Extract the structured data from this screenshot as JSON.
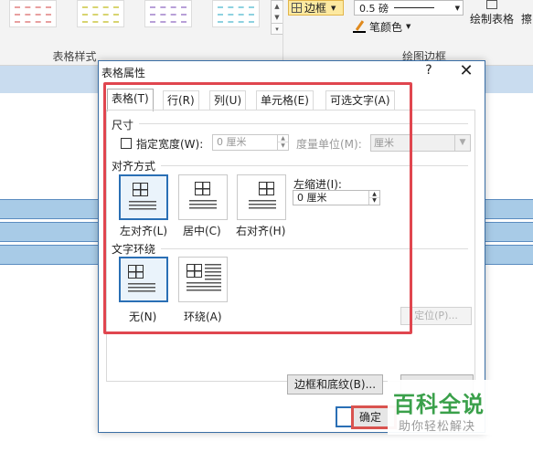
{
  "ribbon": {
    "group_table_styles_label": "表格样式",
    "border_button_label": "边框",
    "pen_weight_value": "0.5 磅",
    "pen_color_label": "笔颜色",
    "draw_table_label": "绘制表格",
    "eraser_label_partial": "擦",
    "group_draw_borders_label": "绘图边框"
  },
  "dialog": {
    "title": "表格属性",
    "help_glyph": "?",
    "close_glyph": "✕",
    "tabs": [
      {
        "label": "表格(T)",
        "active": true
      },
      {
        "label": "行(R)",
        "active": false
      },
      {
        "label": "列(U)",
        "active": false
      },
      {
        "label": "单元格(E)",
        "active": false
      },
      {
        "label": "可选文字(A)",
        "active": false
      }
    ],
    "size": {
      "section_title": "尺寸",
      "preferred_width_label": "指定宽度(W):",
      "preferred_width_checked": false,
      "width_value": "0 厘米",
      "measure_in_label": "度量单位(M):",
      "measure_in_value": "厘米"
    },
    "alignment": {
      "section_title": "对齐方式",
      "options": [
        {
          "label": "左对齐(L)",
          "selected": true,
          "icon": "align-left-icon"
        },
        {
          "label": "居中(C)",
          "selected": false,
          "icon": "align-center-icon"
        },
        {
          "label": "右对齐(H)",
          "selected": false,
          "icon": "align-right-icon"
        }
      ],
      "indent_label": "左缩进(I):",
      "indent_value": "0 厘米"
    },
    "text_wrapping": {
      "section_title": "文字环绕",
      "options": [
        {
          "label": "无(N)",
          "selected": true,
          "icon": "wrap-none-icon"
        },
        {
          "label": "环绕(A)",
          "selected": false,
          "icon": "wrap-around-icon"
        }
      ],
      "position_button_label": "定位(P)..."
    },
    "borders_button_label": "边框和底纹(B)...",
    "ok_button_label": "确定"
  },
  "watermark": {
    "main": "百科全说",
    "sub": "助你轻松解决"
  },
  "colors": {
    "annotation_red": "#e0464f",
    "selection_blue": "#2a6fb5",
    "watermark_green": "#3aa04a"
  }
}
